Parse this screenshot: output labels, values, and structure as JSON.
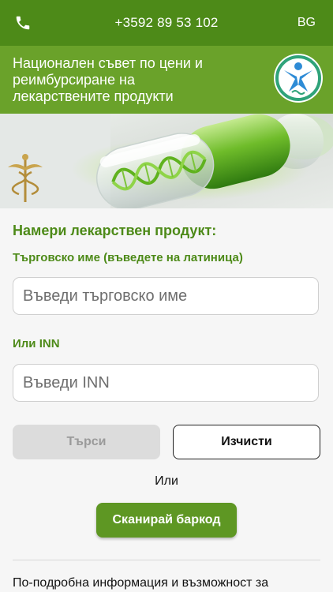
{
  "header": {
    "phone_icon": "phone-icon",
    "phone": "+3592 89 53 102",
    "language": "BG"
  },
  "title": {
    "line1": "Национален съвет по цени и",
    "line2": "реимбурсиране на",
    "line3": "лекарствените продукти",
    "logo_icon": "ncpr-logo-icon"
  },
  "banner": {
    "image": "capsule-dna-banner",
    "caduceus_icon": "caduceus-icon"
  },
  "search": {
    "heading": "Намери лекарствен продукт:",
    "trade_label": "Търговско име  (въведете на латиница)",
    "trade_placeholder": "Въведи търговско име",
    "inn_label": "Или INN",
    "inn_placeholder": "Въведи INN",
    "search_button": "Търси",
    "clear_button": "Изчисти",
    "or_text": "Или",
    "scan_button": "Сканирай баркод"
  },
  "footer": {
    "info_text": "По-подробна информация и възможност за"
  },
  "colors": {
    "topbar": "#4d8a18",
    "titlebar": "#6aa22a",
    "accent": "#5e9723"
  }
}
